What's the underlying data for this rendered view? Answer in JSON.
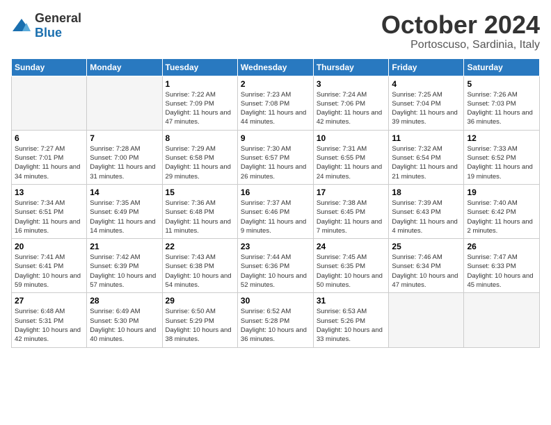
{
  "header": {
    "logo": {
      "general": "General",
      "blue": "Blue"
    },
    "title": "October 2024",
    "location": "Portoscuso, Sardinia, Italy"
  },
  "days_of_week": [
    "Sunday",
    "Monday",
    "Tuesday",
    "Wednesday",
    "Thursday",
    "Friday",
    "Saturday"
  ],
  "weeks": [
    [
      {
        "day": "",
        "info": ""
      },
      {
        "day": "",
        "info": ""
      },
      {
        "day": "1",
        "info": "Sunrise: 7:22 AM\nSunset: 7:09 PM\nDaylight: 11 hours and 47 minutes."
      },
      {
        "day": "2",
        "info": "Sunrise: 7:23 AM\nSunset: 7:08 PM\nDaylight: 11 hours and 44 minutes."
      },
      {
        "day": "3",
        "info": "Sunrise: 7:24 AM\nSunset: 7:06 PM\nDaylight: 11 hours and 42 minutes."
      },
      {
        "day": "4",
        "info": "Sunrise: 7:25 AM\nSunset: 7:04 PM\nDaylight: 11 hours and 39 minutes."
      },
      {
        "day": "5",
        "info": "Sunrise: 7:26 AM\nSunset: 7:03 PM\nDaylight: 11 hours and 36 minutes."
      }
    ],
    [
      {
        "day": "6",
        "info": "Sunrise: 7:27 AM\nSunset: 7:01 PM\nDaylight: 11 hours and 34 minutes."
      },
      {
        "day": "7",
        "info": "Sunrise: 7:28 AM\nSunset: 7:00 PM\nDaylight: 11 hours and 31 minutes."
      },
      {
        "day": "8",
        "info": "Sunrise: 7:29 AM\nSunset: 6:58 PM\nDaylight: 11 hours and 29 minutes."
      },
      {
        "day": "9",
        "info": "Sunrise: 7:30 AM\nSunset: 6:57 PM\nDaylight: 11 hours and 26 minutes."
      },
      {
        "day": "10",
        "info": "Sunrise: 7:31 AM\nSunset: 6:55 PM\nDaylight: 11 hours and 24 minutes."
      },
      {
        "day": "11",
        "info": "Sunrise: 7:32 AM\nSunset: 6:54 PM\nDaylight: 11 hours and 21 minutes."
      },
      {
        "day": "12",
        "info": "Sunrise: 7:33 AM\nSunset: 6:52 PM\nDaylight: 11 hours and 19 minutes."
      }
    ],
    [
      {
        "day": "13",
        "info": "Sunrise: 7:34 AM\nSunset: 6:51 PM\nDaylight: 11 hours and 16 minutes."
      },
      {
        "day": "14",
        "info": "Sunrise: 7:35 AM\nSunset: 6:49 PM\nDaylight: 11 hours and 14 minutes."
      },
      {
        "day": "15",
        "info": "Sunrise: 7:36 AM\nSunset: 6:48 PM\nDaylight: 11 hours and 11 minutes."
      },
      {
        "day": "16",
        "info": "Sunrise: 7:37 AM\nSunset: 6:46 PM\nDaylight: 11 hours and 9 minutes."
      },
      {
        "day": "17",
        "info": "Sunrise: 7:38 AM\nSunset: 6:45 PM\nDaylight: 11 hours and 7 minutes."
      },
      {
        "day": "18",
        "info": "Sunrise: 7:39 AM\nSunset: 6:43 PM\nDaylight: 11 hours and 4 minutes."
      },
      {
        "day": "19",
        "info": "Sunrise: 7:40 AM\nSunset: 6:42 PM\nDaylight: 11 hours and 2 minutes."
      }
    ],
    [
      {
        "day": "20",
        "info": "Sunrise: 7:41 AM\nSunset: 6:41 PM\nDaylight: 10 hours and 59 minutes."
      },
      {
        "day": "21",
        "info": "Sunrise: 7:42 AM\nSunset: 6:39 PM\nDaylight: 10 hours and 57 minutes."
      },
      {
        "day": "22",
        "info": "Sunrise: 7:43 AM\nSunset: 6:38 PM\nDaylight: 10 hours and 54 minutes."
      },
      {
        "day": "23",
        "info": "Sunrise: 7:44 AM\nSunset: 6:36 PM\nDaylight: 10 hours and 52 minutes."
      },
      {
        "day": "24",
        "info": "Sunrise: 7:45 AM\nSunset: 6:35 PM\nDaylight: 10 hours and 50 minutes."
      },
      {
        "day": "25",
        "info": "Sunrise: 7:46 AM\nSunset: 6:34 PM\nDaylight: 10 hours and 47 minutes."
      },
      {
        "day": "26",
        "info": "Sunrise: 7:47 AM\nSunset: 6:33 PM\nDaylight: 10 hours and 45 minutes."
      }
    ],
    [
      {
        "day": "27",
        "info": "Sunrise: 6:48 AM\nSunset: 5:31 PM\nDaylight: 10 hours and 42 minutes."
      },
      {
        "day": "28",
        "info": "Sunrise: 6:49 AM\nSunset: 5:30 PM\nDaylight: 10 hours and 40 minutes."
      },
      {
        "day": "29",
        "info": "Sunrise: 6:50 AM\nSunset: 5:29 PM\nDaylight: 10 hours and 38 minutes."
      },
      {
        "day": "30",
        "info": "Sunrise: 6:52 AM\nSunset: 5:28 PM\nDaylight: 10 hours and 36 minutes."
      },
      {
        "day": "31",
        "info": "Sunrise: 6:53 AM\nSunset: 5:26 PM\nDaylight: 10 hours and 33 minutes."
      },
      {
        "day": "",
        "info": ""
      },
      {
        "day": "",
        "info": ""
      }
    ]
  ]
}
